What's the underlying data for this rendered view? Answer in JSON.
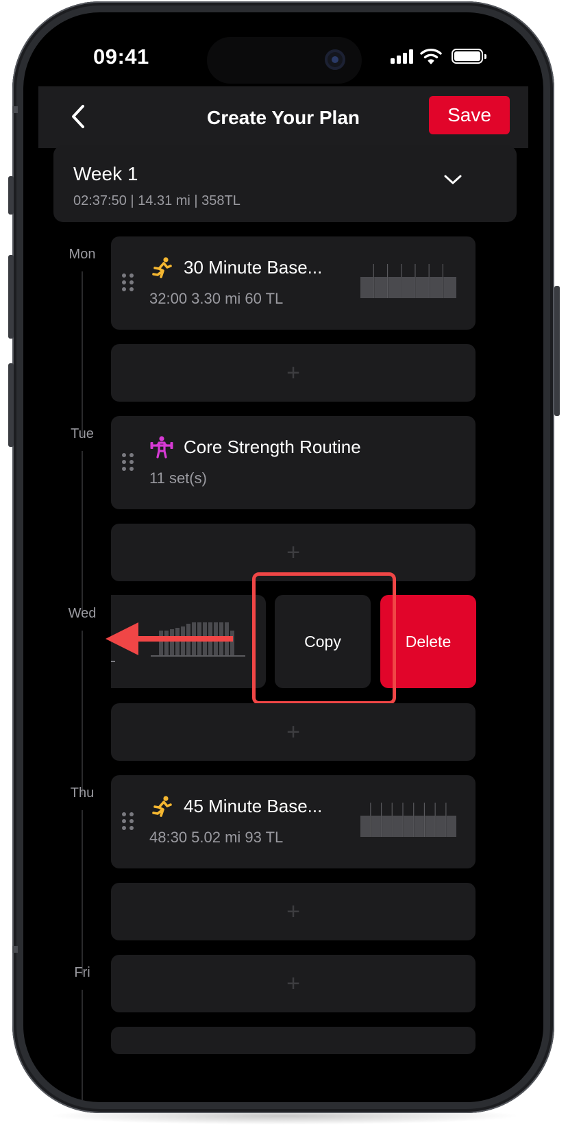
{
  "status_bar": {
    "time": "09:41",
    "icons": [
      "cellular-signal-icon",
      "wifi-icon",
      "battery-icon"
    ]
  },
  "nav": {
    "back_icon": "chevron-left-icon",
    "title": "Create Your Plan",
    "save_label": "Save"
  },
  "week": {
    "title": "Week 1",
    "summary": "02:37:50 | 14.31 mi | 358TL",
    "expand_icon": "chevron-down-icon"
  },
  "days": [
    {
      "label": "Mon",
      "workout": {
        "icon": "running-icon",
        "icon_color": "#f5b731",
        "title": "30 Minute Base...",
        "meta": "32:00  3.30 mi  60 TL",
        "intensity": [
          0.62,
          0.62,
          0.62,
          0.62,
          0.62,
          0.62,
          0.62
        ]
      },
      "add_label": "+"
    },
    {
      "label": "Tue",
      "workout": {
        "icon": "weightlifting-icon",
        "icon_color": "#d63ad4",
        "title": "Core Strength Routine",
        "meta": "11 set(s)"
      },
      "add_label": "+"
    },
    {
      "label": "Wed",
      "swiped": true,
      "actions": {
        "copy_label": "Copy",
        "delete_label": "Delete"
      },
      "add_label": "+"
    },
    {
      "label": "Thu",
      "workout": {
        "icon": "running-icon",
        "icon_color": "#f5b731",
        "title": "45 Minute Base...",
        "meta": "48:30  5.02 mi  93 TL",
        "intensity": [
          0.62,
          0.62,
          0.62,
          0.62,
          0.62,
          0.62,
          0.62,
          0.62,
          0.62
        ]
      },
      "add_label": "+"
    },
    {
      "label": "Fri",
      "add_label": "+"
    }
  ],
  "colors": {
    "accent": "#e1052a",
    "card": "#1c1c1e",
    "highlight": "#f04646"
  }
}
